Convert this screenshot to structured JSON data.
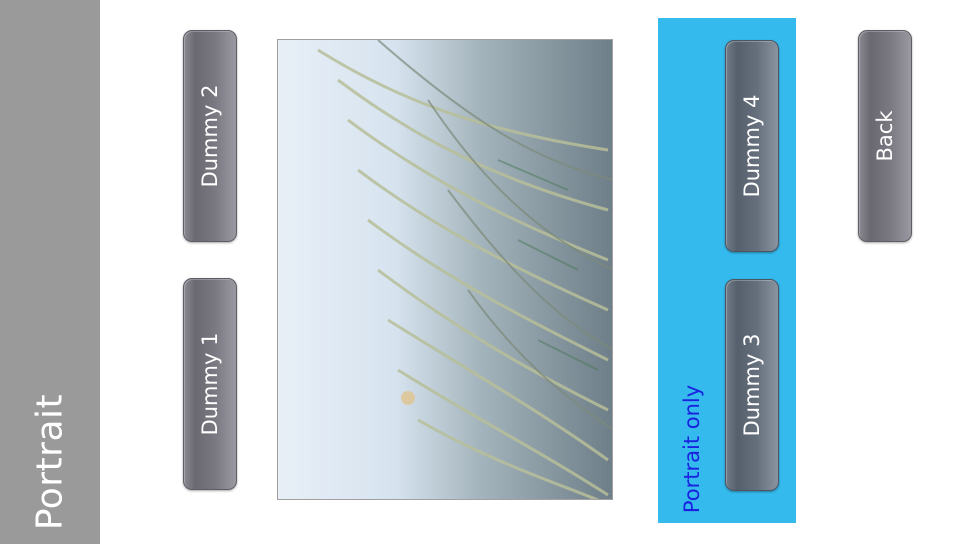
{
  "sidebar": {
    "title": "Portrait"
  },
  "buttons": {
    "dummy1": "Dummy 1",
    "dummy2": "Dummy 2",
    "dummy3": "Dummy 3",
    "dummy4": "Dummy 4",
    "back": "Back"
  },
  "panel": {
    "label": "Portrait only"
  },
  "colors": {
    "sidebar": "#9a9a9a",
    "panel": "#35baee",
    "panel_text": "#1a22e0",
    "button": "#7a7880"
  }
}
